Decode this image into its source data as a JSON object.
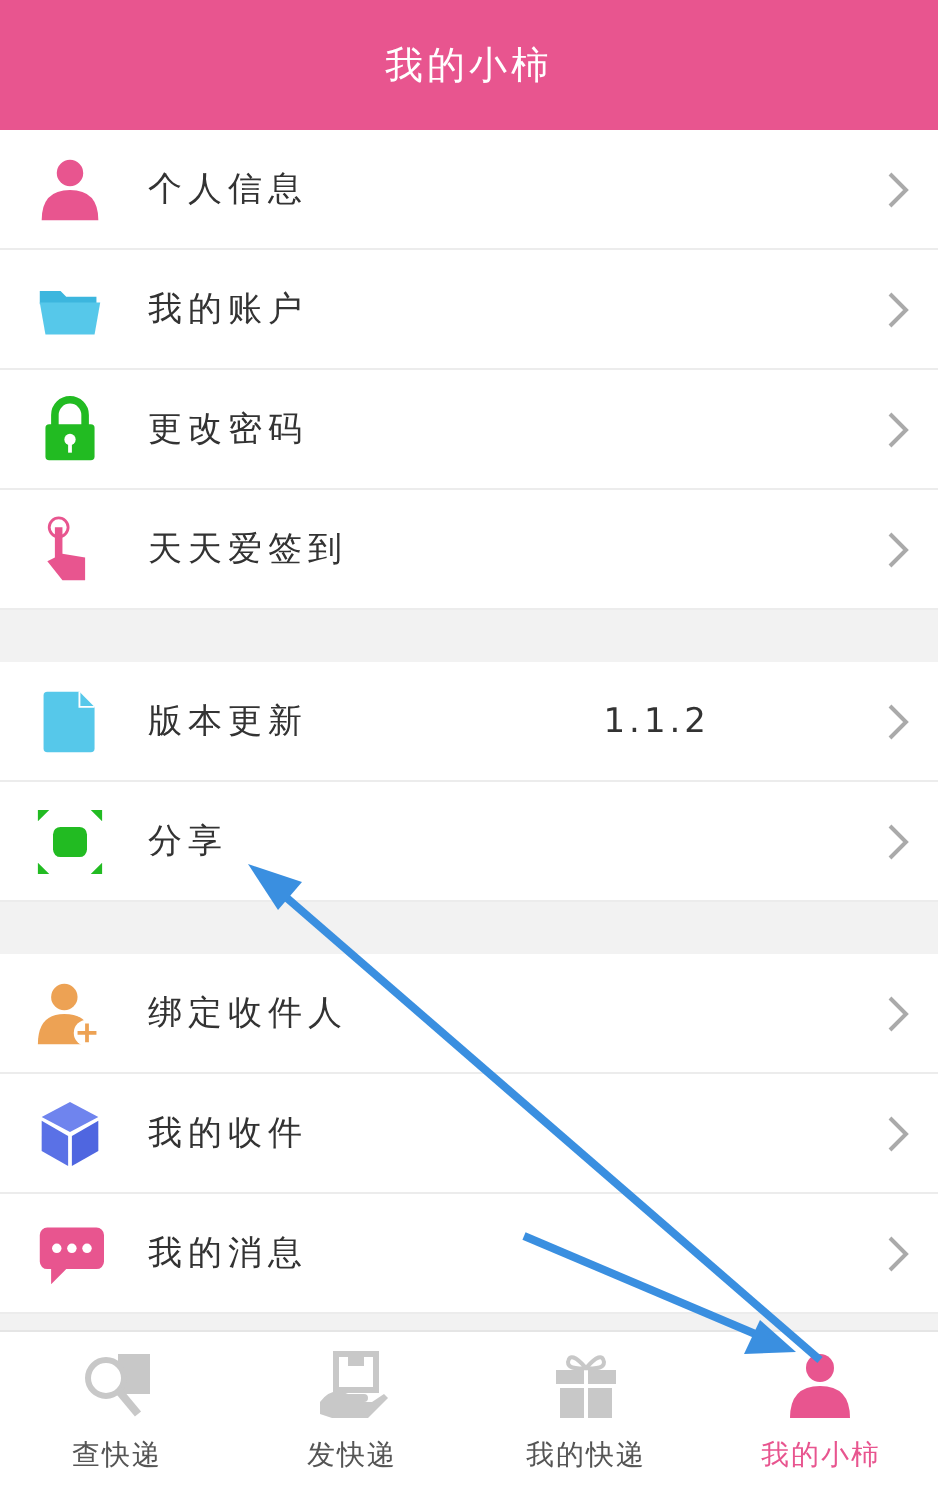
{
  "header": {
    "title": "我的小柿"
  },
  "groups": [
    {
      "items": [
        {
          "label": "个人信息"
        },
        {
          "label": "我的账户"
        },
        {
          "label": "更改密码"
        },
        {
          "label": "天天爱签到"
        }
      ]
    },
    {
      "items": [
        {
          "label": "版本更新",
          "value": "1.1.2"
        },
        {
          "label": "分享"
        }
      ]
    },
    {
      "items": [
        {
          "label": "绑定收件人"
        },
        {
          "label": "我的收件"
        },
        {
          "label": "我的消息"
        }
      ]
    }
  ],
  "tabs": [
    {
      "label": "查快递",
      "selected": false
    },
    {
      "label": "发快递",
      "selected": false
    },
    {
      "label": "我的快递",
      "selected": false
    },
    {
      "label": "我的小柿",
      "selected": true
    }
  ]
}
